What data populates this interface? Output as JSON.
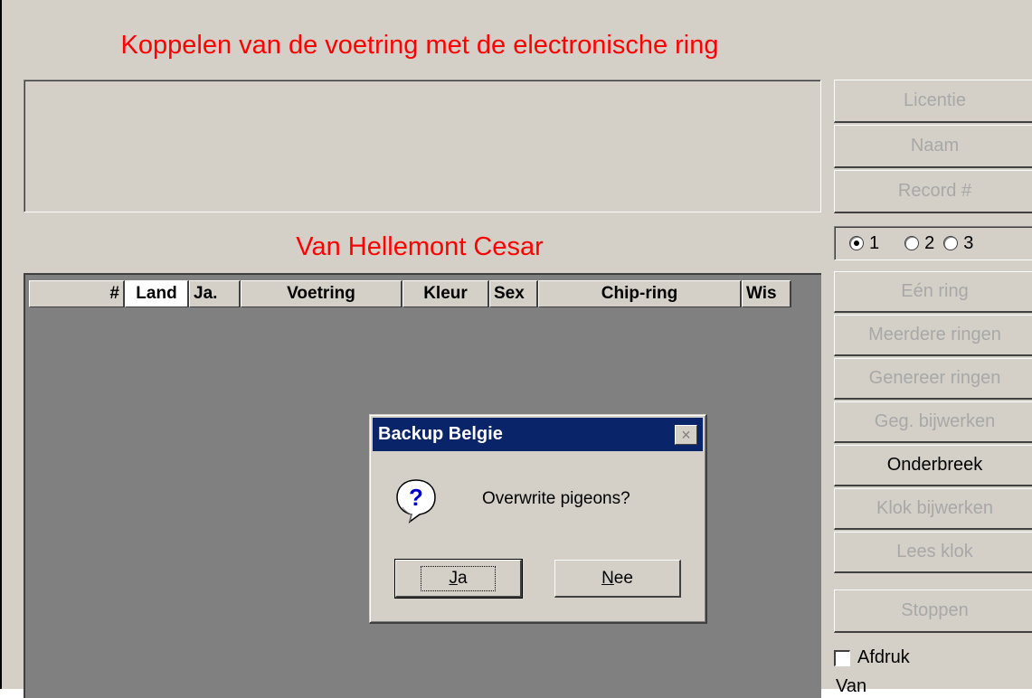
{
  "main_title": "Koppelen van de voetring met de electronische ring",
  "owner_name": "Van Hellemont Cesar",
  "grid": {
    "columns": [
      "#",
      "Land",
      "Ja.",
      "Voetring",
      "Kleur",
      "Sex",
      "Chip-ring",
      "Wis"
    ],
    "rows": []
  },
  "sidebar": {
    "search_buttons": [
      "Licentie",
      "Naam",
      "Record #"
    ],
    "radio_options": [
      "1",
      "2",
      "3"
    ],
    "radio_selected": "1",
    "action_buttons": [
      "Eén ring",
      "Meerdere ringen",
      "Genereer ringen",
      "Geg. bijwerken",
      "Onderbreek",
      "Klok bijwerken",
      "Lees klok"
    ],
    "stop_button": "Stoppen",
    "print_checkbox": "Afdruk",
    "print_checked": false,
    "van_label": "Van"
  },
  "dialog": {
    "title": "Backup Belgie",
    "close_glyph": "×",
    "message": "Overwrite pigeons?",
    "icon": "question-icon",
    "yes": {
      "mnemonic": "J",
      "rest": "a"
    },
    "no": {
      "mnemonic": "N",
      "rest": "ee"
    }
  },
  "colors": {
    "title_red": "#ff0000",
    "face": "#d4d0c8",
    "grid_bg": "#808080",
    "titlebar": "#0a246a",
    "disabled_text": "#a8a8a8"
  }
}
